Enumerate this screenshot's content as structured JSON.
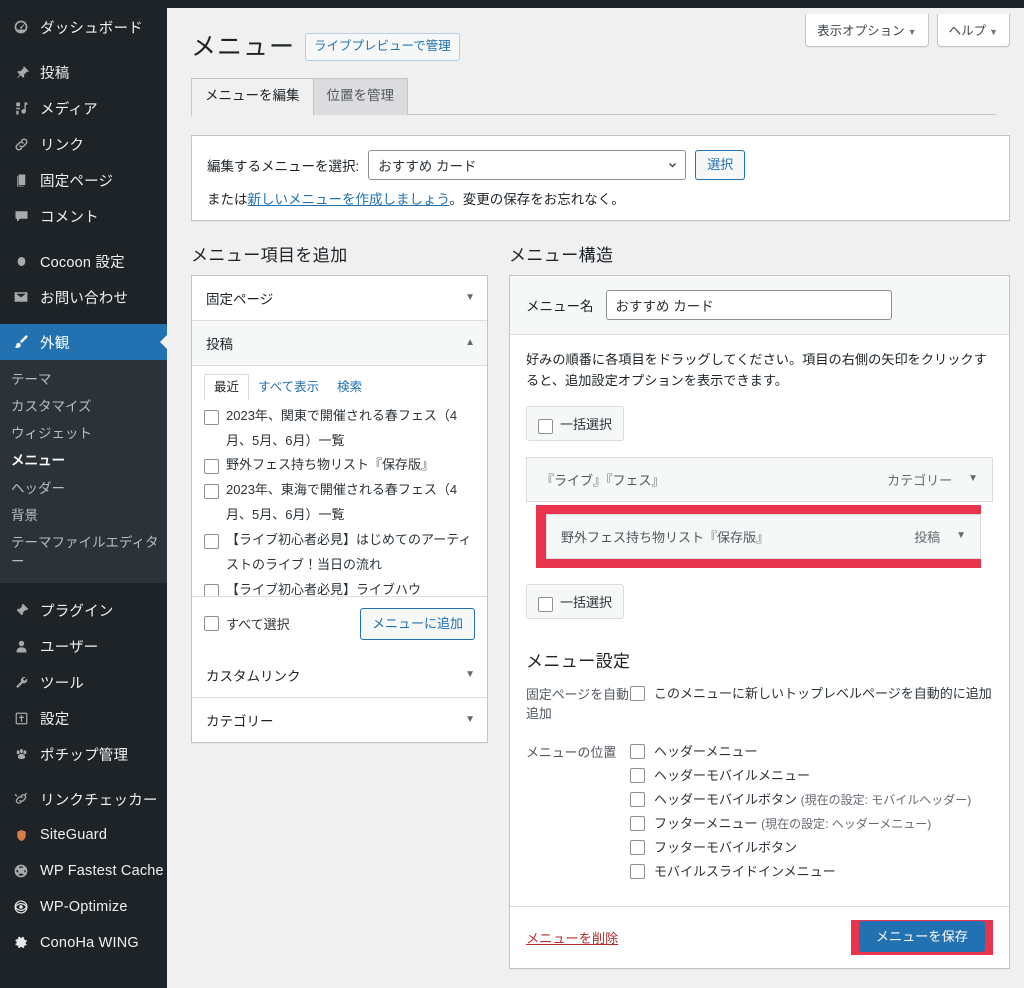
{
  "colors": {
    "sidebar_bg": "#1d2327",
    "sidebar_submenu_bg": "#2c3338",
    "accent_blue": "#2271b1",
    "highlight_red": "#e8344c",
    "delete_red": "#b32d2e",
    "page_bg": "#f0f0f1"
  },
  "sidebar": {
    "items": [
      {
        "icon": "dashboard-icon",
        "label": "ダッシュボード"
      },
      {
        "icon": "pin-icon",
        "label": "投稿"
      },
      {
        "icon": "media-icon",
        "label": "メディア"
      },
      {
        "icon": "link-icon",
        "label": "リンク"
      },
      {
        "icon": "page-icon",
        "label": "固定ページ"
      },
      {
        "icon": "comment-icon",
        "label": "コメント"
      },
      {
        "icon": "cocoon-icon",
        "label": "Cocoon 設定"
      },
      {
        "icon": "mail-icon",
        "label": "お問い合わせ"
      },
      {
        "icon": "appearance-brush-icon",
        "label": "外観"
      },
      {
        "icon": "plugin-icon",
        "label": "プラグイン"
      },
      {
        "icon": "user-icon",
        "label": "ユーザー"
      },
      {
        "icon": "wrench-icon",
        "label": "ツール"
      },
      {
        "icon": "settings-sliders-icon",
        "label": "設定"
      },
      {
        "icon": "paw-icon",
        "label": "ポチップ管理"
      },
      {
        "icon": "link-checker-icon",
        "label": "リンクチェッカー"
      },
      {
        "icon": "siteguard-icon",
        "label": "SiteGuard"
      },
      {
        "icon": "wp-fastest-cache-icon",
        "label": "WP Fastest Cache"
      },
      {
        "icon": "wp-optimize-icon",
        "label": "WP-Optimize"
      },
      {
        "icon": "gear-icon",
        "label": "ConoHa WING"
      }
    ],
    "submenu": [
      {
        "label": "テーマ",
        "current": false
      },
      {
        "label": "カスタマイズ",
        "current": false
      },
      {
        "label": "ウィジェット",
        "current": false
      },
      {
        "label": "メニュー",
        "current": true
      },
      {
        "label": "ヘッダー",
        "current": false
      },
      {
        "label": "背景",
        "current": false
      },
      {
        "label": "テーマファイルエディター",
        "current": false
      }
    ]
  },
  "header": {
    "title": "メニュー",
    "live_preview_button": "ライブプレビューで管理",
    "screen_options": "表示オプション",
    "help": "ヘルプ",
    "caret": "▼"
  },
  "tabs": [
    {
      "label": "メニューを編集",
      "active": true
    },
    {
      "label": "位置を管理",
      "active": false
    }
  ],
  "select_menu": {
    "label": "編集するメニューを選択:",
    "value": "おすすめ カード",
    "select_button": "選択",
    "or_prefix": "または",
    "create_link": "新しいメニューを作成しましょう",
    "after_link": "。変更の保存をお忘れなく。"
  },
  "add_items": {
    "heading": "メニュー項目を追加",
    "accordions": [
      {
        "label": "固定ページ",
        "open": false,
        "tri": "▼"
      },
      {
        "label": "投稿",
        "open": true,
        "tri": "▲"
      },
      {
        "label": "カスタムリンク",
        "open": false,
        "tri": "▼"
      },
      {
        "label": "カテゴリー",
        "open": false,
        "tri": "▼"
      }
    ],
    "post_tabs": [
      {
        "label": "最近",
        "active": true
      },
      {
        "label": "すべて表示",
        "active": false
      },
      {
        "label": "検索",
        "active": false
      }
    ],
    "posts": [
      "2023年、関東で開催される春フェス（4月、5月、6月）一覧",
      "野外フェス持ち物リスト『保存版』",
      "2023年、東海で開催される春フェス（4月、5月、6月）一覧",
      "【ライブ初心者必見】はじめてのアーティストのライブ！当日の流れ",
      "【ライブ初心者必見】ライブハウ"
    ],
    "select_all": "すべて選択",
    "add_to_menu_button": "メニューに追加"
  },
  "structure": {
    "heading": "メニュー構造",
    "name_label": "メニュー名",
    "name_value": "おすすめ カード",
    "help_text": "好みの順番に各項目をドラッグしてください。項目の右側の矢印をクリックすると、追加設定オプションを表示できます。",
    "bulk_select_top": "一括選択",
    "bulk_select_bottom": "一括選択",
    "items": [
      {
        "label": "『ライブ』『フェス』",
        "type": "カテゴリー",
        "tri": "▼",
        "highlighted": false
      },
      {
        "label": "野外フェス持ち物リスト『保存版』",
        "type": "投稿",
        "tri": "▼",
        "highlighted": true
      }
    ]
  },
  "settings": {
    "heading": "メニュー設定",
    "auto_add_label": "固定ページを自動追加",
    "auto_add_option": "このメニューに新しいトップレベルページを自動的に追加",
    "positions_label": "メニューの位置",
    "positions": [
      {
        "label": "ヘッダーメニュー",
        "note": ""
      },
      {
        "label": "ヘッダーモバイルメニュー",
        "note": ""
      },
      {
        "label": "ヘッダーモバイルボタン",
        "note": "(現在の設定: モバイルヘッダー)"
      },
      {
        "label": "フッターメニュー",
        "note": "(現在の設定: ヘッダーメニュー)"
      },
      {
        "label": "フッターモバイルボタン",
        "note": ""
      },
      {
        "label": "モバイルスライドインメニュー",
        "note": ""
      }
    ]
  },
  "footer": {
    "delete_link": "メニューを削除",
    "save_button": "メニューを保存"
  }
}
